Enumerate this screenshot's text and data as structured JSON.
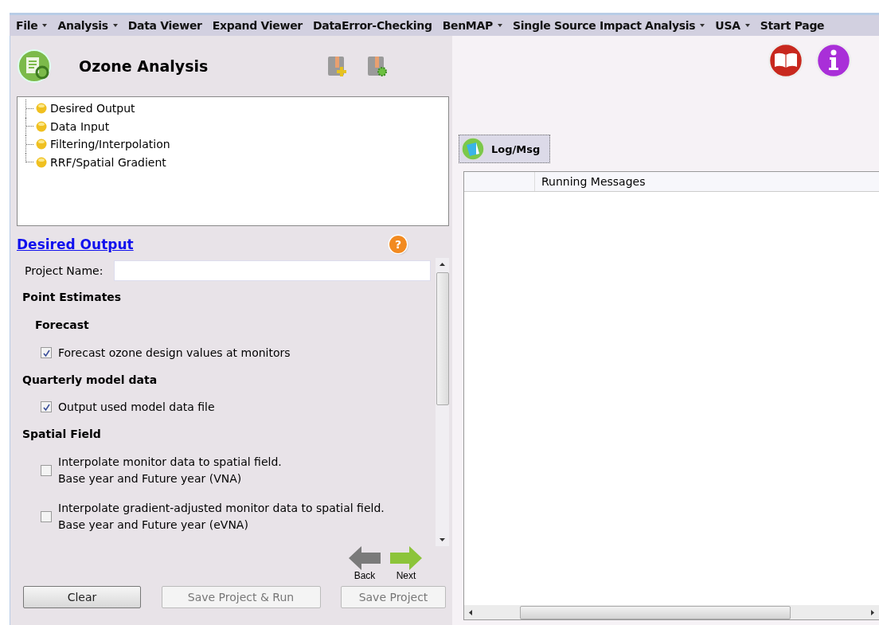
{
  "menu": [
    {
      "label": "File",
      "has_dropdown": true
    },
    {
      "label": "Analysis",
      "has_dropdown": true
    },
    {
      "label": "Data Viewer",
      "has_dropdown": false
    },
    {
      "label": "Expand Viewer",
      "has_dropdown": false
    },
    {
      "label": "DataError-Checking",
      "has_dropdown": false
    },
    {
      "label": "BenMAP",
      "has_dropdown": true
    },
    {
      "label": "Single Source Impact Analysis",
      "has_dropdown": true
    },
    {
      "label": "USA",
      "has_dropdown": true
    },
    {
      "label": "Start Page",
      "has_dropdown": false
    }
  ],
  "left_panel": {
    "title": "Ozone Analysis",
    "tree": [
      "Desired Output",
      "Data Input",
      "Filtering/Interpolation",
      "RRF/Spatial Gradient"
    ],
    "section_link": "Desired Output",
    "help_mark": "?",
    "project_name": {
      "label": "Project Name:"
    },
    "form": [
      {
        "kind": "heading",
        "text": "Point Estimates"
      },
      {
        "kind": "subheading",
        "text": "Forecast"
      },
      {
        "kind": "checkbox",
        "lines": [
          "Forecast ozone design values at monitors"
        ],
        "checked": true
      },
      {
        "kind": "heading",
        "text": "Quarterly model data"
      },
      {
        "kind": "checkbox",
        "lines": [
          "Output used model data file"
        ],
        "checked": true
      },
      {
        "kind": "heading",
        "text": "Spatial Field"
      },
      {
        "kind": "checkbox",
        "lines": [
          "Interpolate monitor data to spatial field.",
          "Base year and Future year (VNA)"
        ],
        "checked": false
      },
      {
        "kind": "checkbox",
        "lines": [
          "Interpolate gradient-adjusted monitor data to spatial field.",
          "Base year and Future year (eVNA)"
        ],
        "checked": false
      }
    ],
    "back": "Back",
    "next": "Next",
    "buttons": [
      {
        "label": "Clear",
        "disabled": false
      },
      {
        "label": "Save Project & Run",
        "disabled": true
      },
      {
        "label": "Save Project",
        "disabled": true
      }
    ]
  },
  "right_panel": {
    "tabs": [
      {
        "label": "Log/Msg",
        "selected": true
      }
    ],
    "grid": {
      "column_header": "Running Messages"
    }
  }
}
